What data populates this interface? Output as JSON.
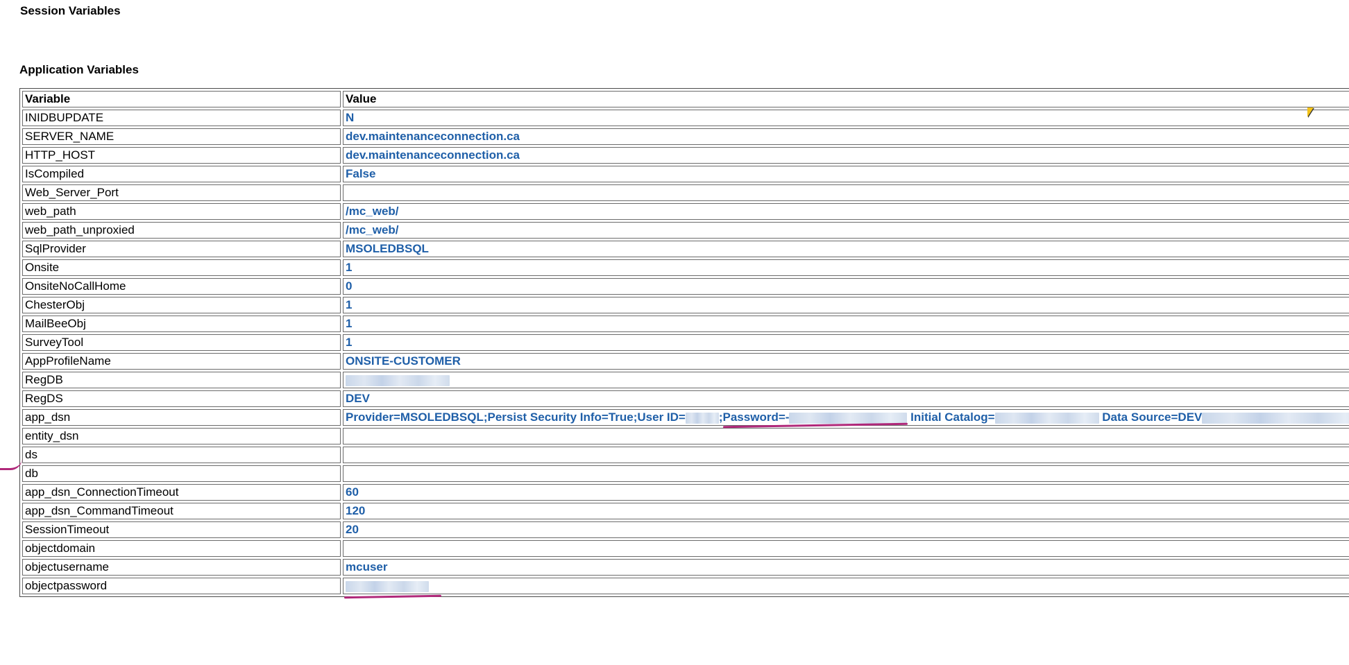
{
  "session_section": {
    "title": "Session Variables"
  },
  "application_section": {
    "title": "Application Variables",
    "table": {
      "headers": {
        "variable": "Variable",
        "value": "Value"
      },
      "rows": [
        {
          "name": "INIDBUPDATE",
          "value": "N"
        },
        {
          "name": "SERVER_NAME",
          "value": "dev.maintenanceconnection.ca"
        },
        {
          "name": "HTTP_HOST",
          "value": "dev.maintenanceconnection.ca"
        },
        {
          "name": "IsCompiled",
          "value": "False"
        },
        {
          "name": "Web_Server_Port",
          "value": ""
        },
        {
          "name": "web_path",
          "value": "/mc_web/"
        },
        {
          "name": "web_path_unproxied",
          "value": "/mc_web/"
        },
        {
          "name": "SqlProvider",
          "value": "MSOLEDBSQL"
        },
        {
          "name": "Onsite",
          "value": "1"
        },
        {
          "name": "OnsiteNoCallHome",
          "value": "0"
        },
        {
          "name": "ChesterObj",
          "value": "1"
        },
        {
          "name": "MailBeeObj",
          "value": "1"
        },
        {
          "name": "SurveyTool",
          "value": "1"
        },
        {
          "name": "AppProfileName",
          "value": "ONSITE-CUSTOMER"
        },
        {
          "name": "RegDB",
          "value": ""
        },
        {
          "name": "RegDS",
          "value": "DEV"
        },
        {
          "name": "app_dsn",
          "value": ""
        },
        {
          "name": "entity_dsn",
          "value": ""
        },
        {
          "name": "ds",
          "value": ""
        },
        {
          "name": "db",
          "value": ""
        },
        {
          "name": "app_dsn_ConnectionTimeout",
          "value": "60"
        },
        {
          "name": "app_dsn_CommandTimeout",
          "value": "120"
        },
        {
          "name": "SessionTimeout",
          "value": "20"
        },
        {
          "name": "objectdomain",
          "value": ""
        },
        {
          "name": "objectusername",
          "value": "mcuser"
        },
        {
          "name": "objectpassword",
          "value": ""
        }
      ],
      "app_dsn_parts": {
        "provider": "Provider=MSOLEDBSQL;Persist Security Info=True;User ID=",
        "sep": ";",
        "password": "Password=-",
        "catalog": "Initial Catalog=",
        "datasource": "Data Source=DEV"
      }
    }
  },
  "colors": {
    "value_text": "#1f5fa8",
    "annotation": "#b0287a",
    "cursor": "#f3c218"
  }
}
